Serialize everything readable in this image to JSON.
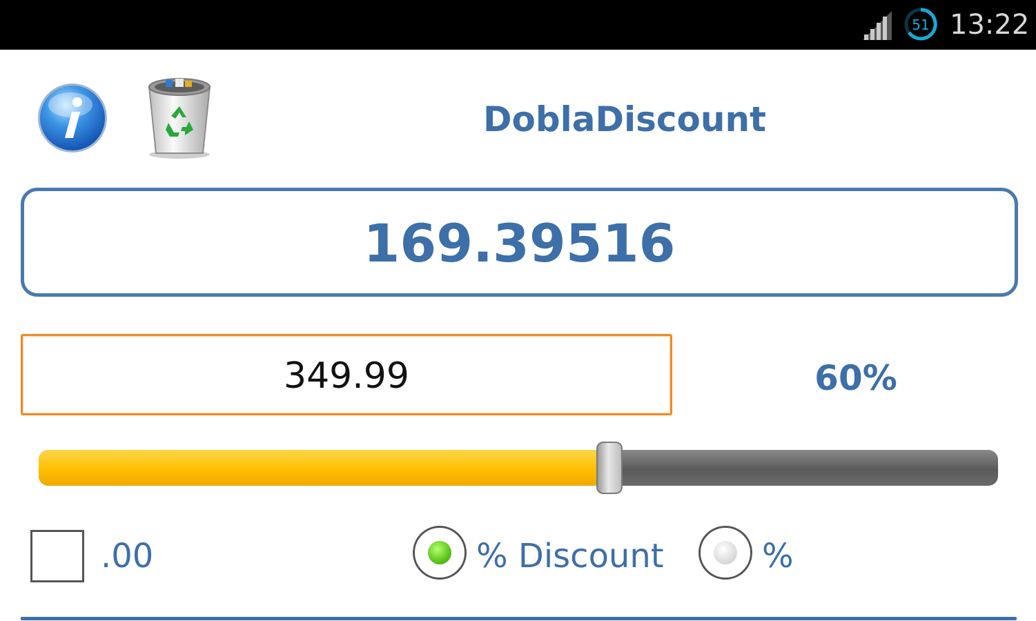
{
  "status_bar": {
    "time": "13:22",
    "battery_level": "51",
    "signal_icon": "signal-bars-icon",
    "battery_icon": "circular-battery-icon"
  },
  "header": {
    "info_icon": "info-icon",
    "trash_icon": "recycle-bin-icon",
    "title": "DoblaDiscount"
  },
  "result": {
    "value": "169.39516"
  },
  "price_input": {
    "value": "349.99"
  },
  "discount": {
    "percent_label": "60%",
    "slider_fraction": 0.595
  },
  "options": {
    "decimals_label": ".00",
    "decimals_checked": false,
    "radio_discount_label": "% Discount",
    "radio_percent_label": "%",
    "selected": "discount"
  },
  "colors": {
    "accent_blue": "#3d6fa8",
    "input_focus_orange": "#f08a24",
    "slider_fill": "#ffbf00",
    "slider_track": "#6a6a6a",
    "status_bar": "#000000"
  }
}
